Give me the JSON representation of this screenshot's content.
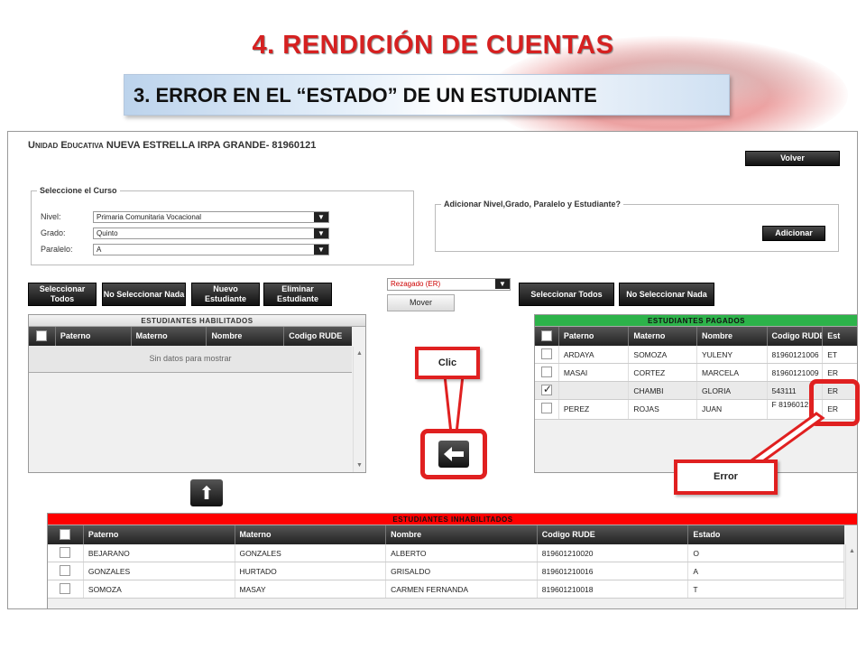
{
  "slide": {
    "title": "4. RENDICIÓN  DE CUENTAS",
    "subtitle": "3. ERROR EN EL “ESTADO” DE UN ESTUDIANTE"
  },
  "app": {
    "school_prefix": "Unidad Educativa",
    "school_name": " NUEVA ESTRELLA IRPA GRANDE- 81960121",
    "back_button": "Volver",
    "course_legend": "Seleccione el Curso",
    "fields": [
      {
        "label": "Nivel:",
        "value": "Primaria Comunitaria Vocacional"
      },
      {
        "label": "Grado:",
        "value": "Quinto"
      },
      {
        "label": "Paralelo:",
        "value": "A"
      }
    ],
    "add_legend": "Adicionar Nivel,Grado, Paralelo y Estudiante?",
    "add_button": "Adicionar",
    "left_buttons": [
      "Seleccionar Todos",
      "No Seleccionar Nada",
      "Nuevo Estudiante",
      "Eliminar Estudiante"
    ],
    "status_select": "Rezagado (ER)",
    "move_button": "Mover",
    "right_buttons": [
      "Seleccionar Todos",
      "No Seleccionar Nada"
    ],
    "enabled_table": {
      "title": "ESTUDIANTES HABILITADOS",
      "columns": [
        "Paterno",
        "Materno",
        "Nombre",
        "Codigo RUDE"
      ],
      "empty_text": "Sin datos para mostrar"
    },
    "paid_table": {
      "title": "ESTUDIANTES PAGADOS",
      "columns": [
        "Paterno",
        "Materno",
        "Nombre",
        "Codigo RUDE",
        "Est"
      ],
      "rows": [
        {
          "checked": false,
          "paterno": "ARDAYA",
          "materno": "SOMOZA",
          "nombre": "YULENY",
          "rude": "81960121006",
          "est": "ET"
        },
        {
          "checked": false,
          "paterno": "MASAI",
          "materno": "CORTEZ",
          "nombre": "MARCELA",
          "rude": "81960121009",
          "est": "ER"
        },
        {
          "checked": true,
          "paterno": "",
          "materno": "CHAMBI",
          "nombre": "GLORIA",
          "rude": "543111",
          "est": "ER"
        },
        {
          "checked": false,
          "paterno": "PEREZ",
          "materno": "ROJAS",
          "nombre": "JUAN",
          "rude": "F 81960121",
          "est": "ER"
        }
      ]
    },
    "disabled_table": {
      "title": "ESTUDIANTES INHABILITADOS",
      "columns": [
        "Paterno",
        "Materno",
        "Nombre",
        "Codigo RUDE",
        "Estado"
      ],
      "rows": [
        {
          "paterno": "BEJARANO",
          "materno": "GONZALES",
          "nombre": "ALBERTO",
          "rude": "819601210020",
          "estado": "O"
        },
        {
          "paterno": "GONZALES",
          "materno": "HURTADO",
          "nombre": "GRISALDO",
          "rude": "819601210016",
          "estado": "A"
        },
        {
          "paterno": "SOMOZA",
          "materno": "MASAY",
          "nombre": "CARMEN FERNANDA",
          "rude": "819601210018",
          "estado": "T"
        }
      ]
    }
  },
  "annotations": {
    "click_label": "Clic",
    "error_label": "Error"
  },
  "colors": {
    "title_red": "#d62020",
    "callout_red": "#e02020",
    "paid_header_green": "#2db34a",
    "disabled_header_red": "#ff0000"
  },
  "icons": {
    "move_left": "arrow-left-icon",
    "move_up": "arrow-up-icon"
  }
}
